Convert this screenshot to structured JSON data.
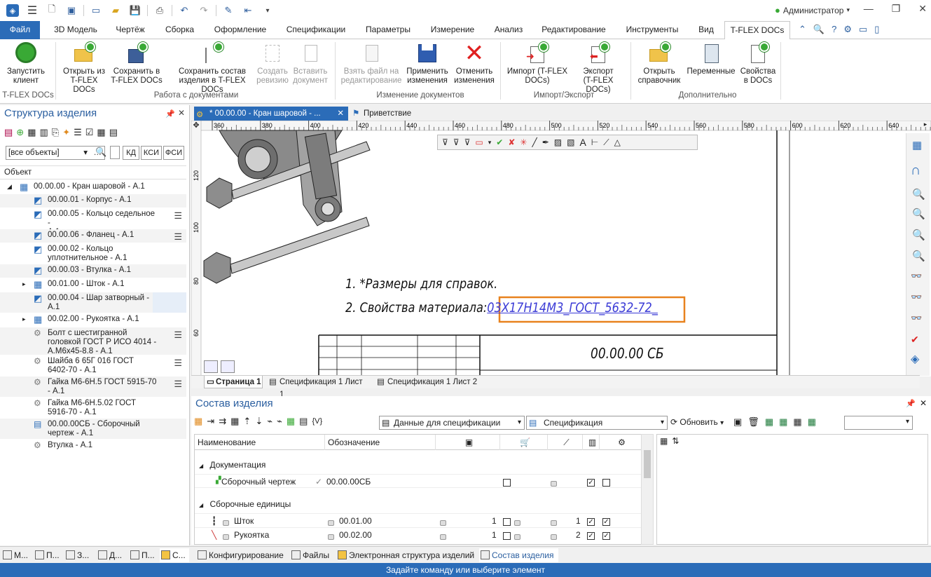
{
  "quick_access": {
    "user": "Администратор"
  },
  "tabs": [
    "Файл",
    "3D Модель",
    "Чертёж",
    "Сборка",
    "Оформление",
    "Спецификации",
    "Параметры",
    "Измерение",
    "Анализ",
    "Редактирование",
    "Инструменты",
    "Вид",
    "T-FLEX DOCs"
  ],
  "ribbon": {
    "buttons": [
      {
        "label": "Запустить\nклиент"
      },
      {
        "label": "Открыть из\nT-FLEX DOCs"
      },
      {
        "label": "Сохранить в\nT-FLEX DOCs"
      },
      {
        "label": "Сохранить состав\nизделия в T-FLEX DOCs"
      },
      {
        "label": "Создать\nревизию"
      },
      {
        "label": "Вставить\nдокумент"
      },
      {
        "label": "Взять файл на\nредактирование"
      },
      {
        "label": "Применить\nизменения"
      },
      {
        "label": "Отменить\nизменения"
      },
      {
        "label": "Импорт (T-FLEX\nDOCs)"
      },
      {
        "label": "Экспорт\n(T-FLEX DOCs)"
      },
      {
        "label": "Открыть\nсправочник"
      },
      {
        "label": "Переменные"
      },
      {
        "label": "Свойства\nв DOCs"
      }
    ],
    "groups": [
      "T-FLEX DOCs",
      "Работа с документами",
      "Изменение документов",
      "Импорт/Экспорт",
      "Дополнительно"
    ]
  },
  "structure": {
    "title": "Структура изделия",
    "filter": "[все объекты]",
    "filter_buttons": [
      "КД",
      "КСИ",
      "ФСИ"
    ],
    "column": "Объект",
    "items": [
      {
        "text": "00.00.00 - Кран шаровой - А.1"
      },
      {
        "text": "00.00.01 - Корпус - А.1"
      },
      {
        "text": "00.00.05 - Кольцо седельное -\nА.1"
      },
      {
        "text": "00.00.06 - Фланец - А.1"
      },
      {
        "text": "00.00.02 - Кольцо\nуплотнительное - А.1"
      },
      {
        "text": "00.00.03 - Втулка - А.1"
      },
      {
        "text": "00.01.00 - Шток - А.1"
      },
      {
        "text": "00.00.04 - Шар затворный -\nА.1"
      },
      {
        "text": "00.02.00 - Рукоятка - А.1"
      },
      {
        "text": "Болт с шестигранной\nголовкой ГОСТ Р ИСО 4014 -\nА.М6х45-8.8 - А.1"
      },
      {
        "text": "Шайба 6 65Г 016 ГОСТ\n6402-70 - А.1"
      },
      {
        "text": "Гайка М6-6Н.5 ГОСТ 5915-70\n- А.1"
      },
      {
        "text": "Гайка М6-6Н.5.02 ГОСТ\n5916-70 - А.1"
      },
      {
        "text": "00.00.00СБ - Сборочный\nчертеж - А.1"
      },
      {
        "text": "Втулка  - А.1"
      }
    ]
  },
  "doc_tabs": [
    "* 00.00.00 - Кран шаровой - ...",
    "Приветствие"
  ],
  "ruler": [
    "360",
    "380",
    "400",
    "420",
    "440",
    "460",
    "480",
    "500",
    "520",
    "540",
    "560",
    "580",
    "600",
    "620",
    "640"
  ],
  "vruler": [
    "120",
    "100",
    "80",
    "60"
  ],
  "drawing": {
    "note1": "1. *Размеры для справок.",
    "note2_prefix": "2. Свойства материала:",
    "note2_link": "03Х17Н14М3_ГОСТ_5632-72_",
    "stamp_code": "00.00.00 СБ"
  },
  "sheet_tabs": [
    "Страница 1",
    "Спецификация 1 Лист 1",
    "Спецификация 1 Лист 2"
  ],
  "composition": {
    "title": "Состав изделия",
    "datasource": "Данные для спецификации",
    "spec": "Спецификация",
    "refresh": "Обновить",
    "vars_label": "{V}",
    "headers": [
      "Наименование",
      "Обозначение"
    ],
    "sections": [
      {
        "name": "Документация",
        "rows": [
          {
            "name": "Сборочный чертеж",
            "designation": "00.00.00СБ",
            "qty": "",
            "pos": ""
          }
        ]
      },
      {
        "name": "Сборочные единицы",
        "rows": [
          {
            "name": "Шток",
            "designation": "00.01.00",
            "qty": "1",
            "pos": "1"
          },
          {
            "name": "Рукоятка",
            "designation": "00.02.00",
            "qty": "1",
            "pos": "2"
          }
        ]
      }
    ]
  },
  "panel_tabs": [
    "М...",
    "П...",
    "З...",
    "Д...",
    "П...",
    "С...",
    "Конфигурирование",
    "Файлы",
    "Электронная структура изделий",
    "Состав изделия"
  ],
  "status": "Задайте команду или выберите элемент",
  "colors": {
    "accent": "#2b6cb8",
    "link": "#3b3bd6",
    "highlight": "#e8821e"
  }
}
